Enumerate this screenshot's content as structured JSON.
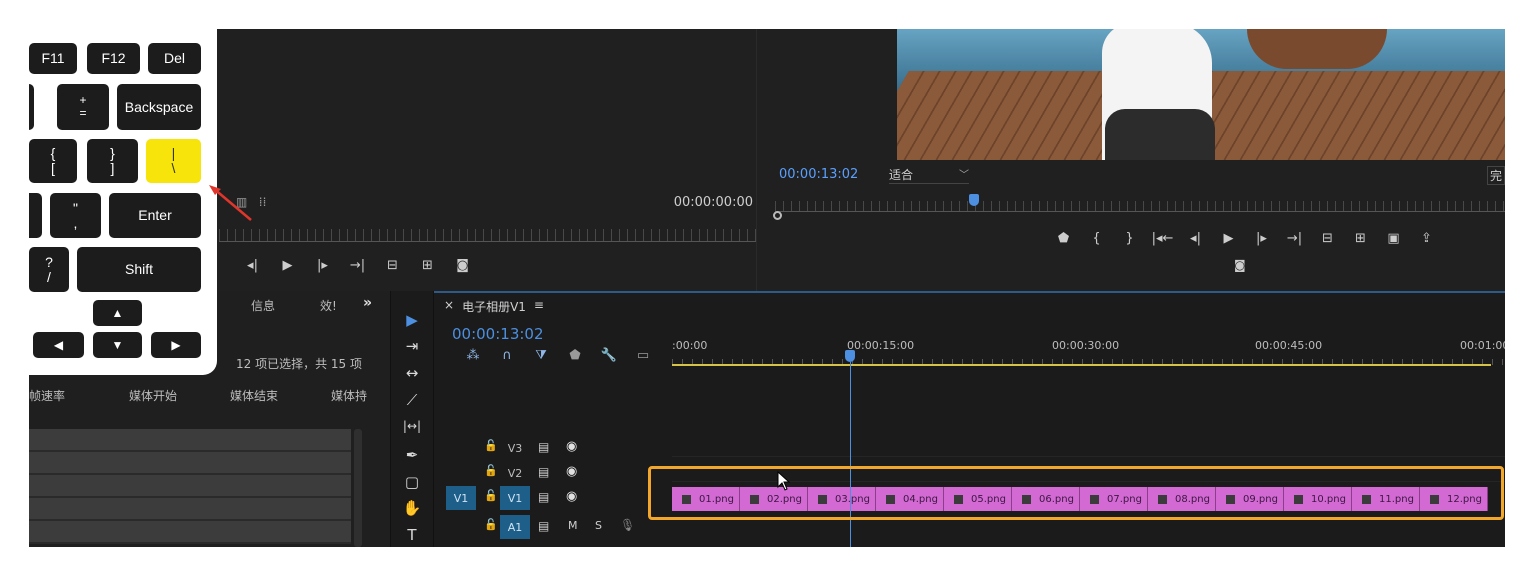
{
  "keyboard": {
    "f11": "F11",
    "f12": "F12",
    "del": "Del",
    "plus_equals": "+\n=",
    "backspace": "Backspace",
    "brace_left": "{\n[",
    "brace_right": "}\n]",
    "pipe_backslash": "|\n\\",
    "quote": "\"\n,",
    "enter": "Enter",
    "question_slash": "?\n/",
    "shift": "Shift",
    "up": "▲",
    "left": "◀",
    "down": "▼",
    "right": "▶"
  },
  "source_monitor": {
    "timecode": "00:00:00:00",
    "controls": [
      "◂|",
      "▶",
      "|▸",
      "→|",
      "⊟",
      "⊞",
      "◙"
    ],
    "add": "+"
  },
  "program_monitor": {
    "timecode": "00:00:13:02",
    "fit": "适合",
    "quality": "完",
    "controls": [
      "⬟",
      "{",
      "}",
      "|◂←",
      "◂|",
      "▶",
      "|▸",
      "→|",
      "⊟",
      "⊞",
      "▣",
      "⇪"
    ],
    "camera": "◙"
  },
  "project_panel": {
    "tab_info": "信息",
    "tab_effects": "效!",
    "more": "»",
    "selection_info": "12 项已选择，共 15 项",
    "columns": [
      "帧速率",
      "媒体开始",
      "媒体结束",
      "媒体持"
    ]
  },
  "tools": [
    "▶",
    "⇥",
    "↔",
    "⟋",
    "|↔|",
    "✒",
    "▢",
    "✋",
    "T"
  ],
  "timeline": {
    "close": "×",
    "sequence_name": "电子相册V1",
    "menu": "≡",
    "timecode": "00:00:13:02",
    "tool_icons": [
      "⁂",
      "∩",
      "⧩",
      "⬟",
      "🔧",
      "▭"
    ],
    "ruler_labels": [
      ":00:00",
      "00:00:15:00",
      "00:00:30:00",
      "00:00:45:00",
      "00:01:00"
    ],
    "tracks": [
      {
        "name": "V3",
        "lock": "🔒",
        "kind": "video"
      },
      {
        "name": "V2",
        "lock": "🔒",
        "kind": "video"
      },
      {
        "name": "V1",
        "lock": "🔒",
        "kind": "video",
        "source": "V1"
      },
      {
        "name": "A1",
        "lock": "🔒",
        "kind": "audio",
        "m": "M",
        "s": "S"
      }
    ],
    "clips": [
      "01.png",
      "02.png",
      "03.png",
      "04.png",
      "05.png",
      "06.png",
      "07.png",
      "08.png",
      "09.png",
      "10.png",
      "11.png",
      "12.png"
    ]
  },
  "colors": {
    "accent_blue": "#4d8fe0",
    "clip_pink": "#d36ad4",
    "highlight_orange": "#f3a72a",
    "key_yellow": "#f6e40a"
  }
}
